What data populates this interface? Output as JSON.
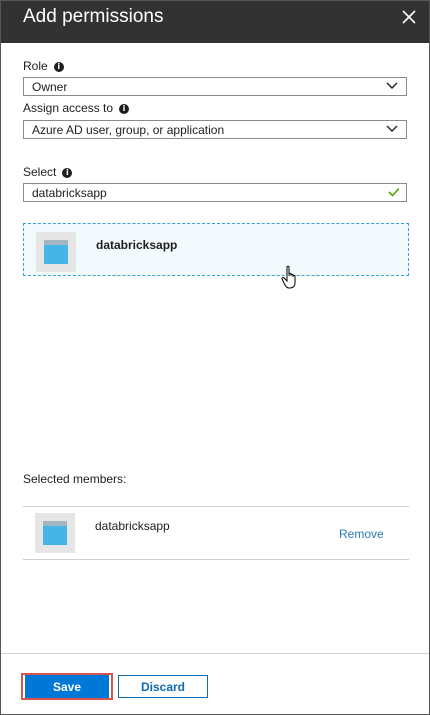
{
  "header": {
    "title": "Add permissions",
    "close_icon": "close-icon"
  },
  "role": {
    "label": "Role",
    "value": "Owner"
  },
  "assign": {
    "label": "Assign access to",
    "value": "Azure AD user, group, or application"
  },
  "select": {
    "label": "Select",
    "value": "databricksapp"
  },
  "search_results": [
    {
      "name": "databricksapp"
    }
  ],
  "selected_members": {
    "label": "Selected members:",
    "items": [
      {
        "name": "databricksapp",
        "action": "Remove"
      }
    ]
  },
  "footer": {
    "save_label": "Save",
    "discard_label": "Discard"
  },
  "colors": {
    "header_bg": "#323232",
    "accent": "#0078d7",
    "highlight_border": "#d9534f",
    "check": "#57a300",
    "link": "#2a7ab0"
  }
}
